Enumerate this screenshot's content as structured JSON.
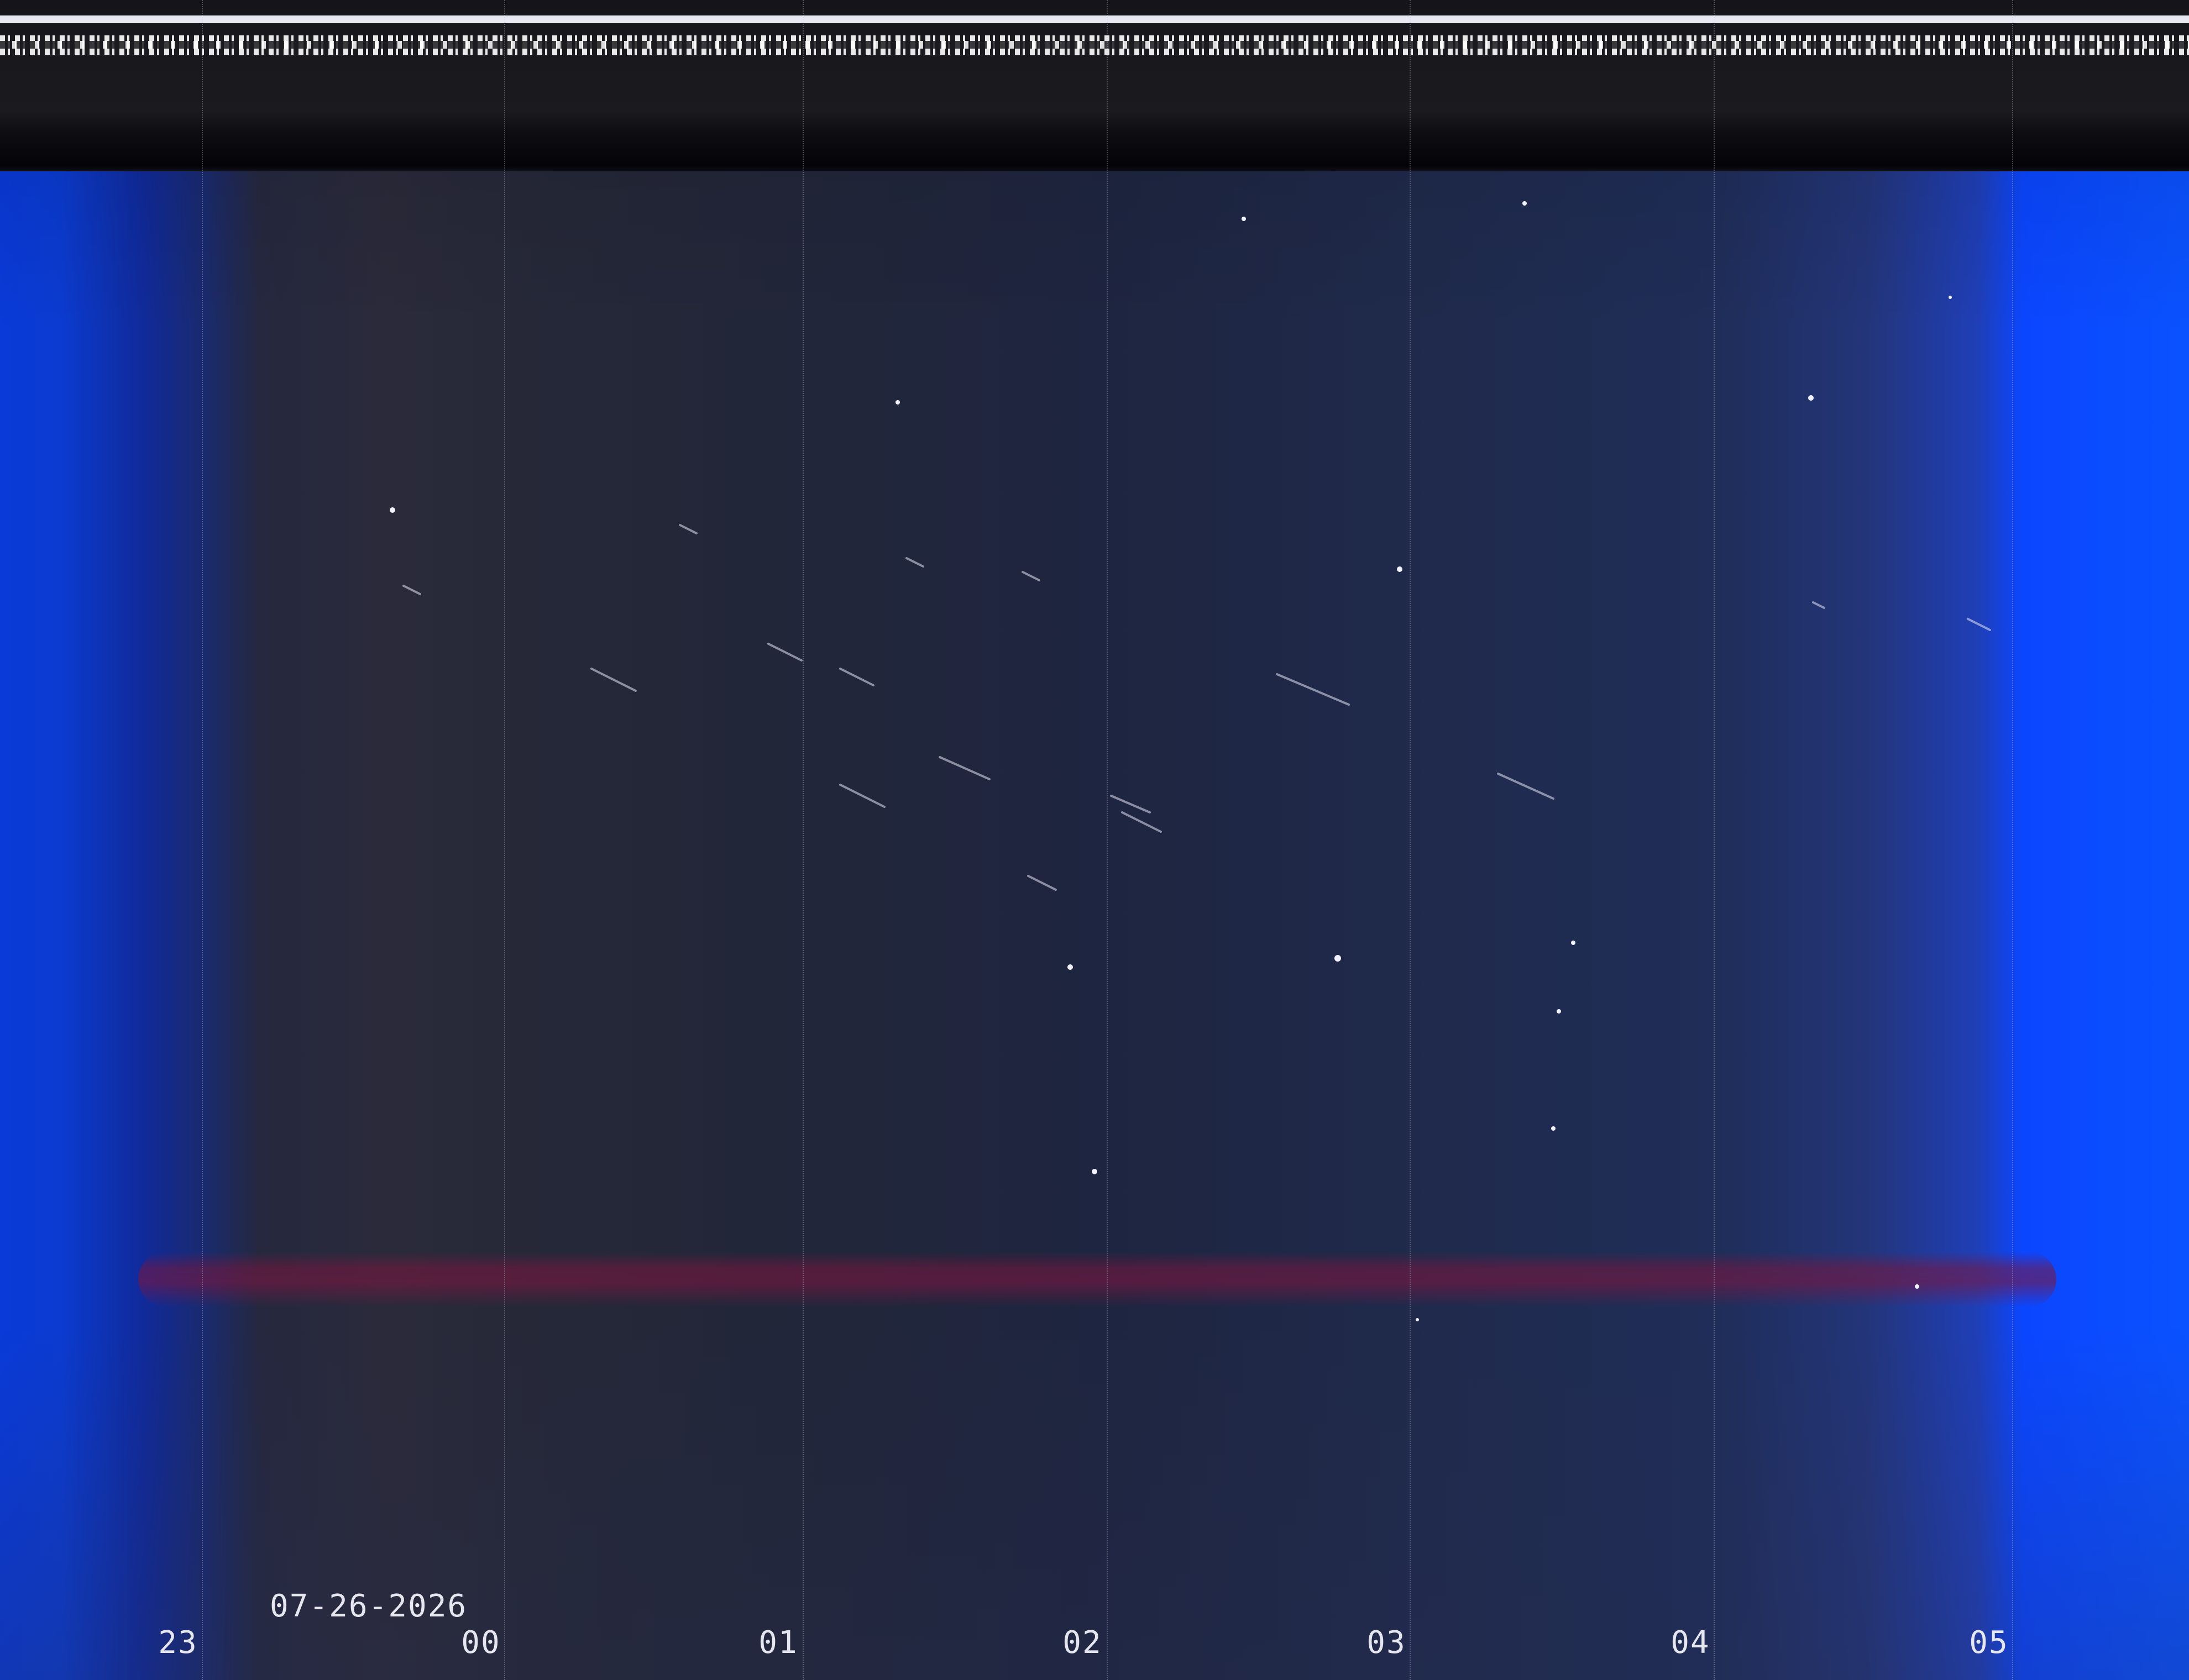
{
  "image": {
    "description_colors": {
      "sky": "#22263a",
      "dawn_edge": "#0a4cff",
      "dusk_edge": "#0a3ad8",
      "red_band": "#7a1640",
      "label_text": "#e6e6ee",
      "header": "#15151b"
    }
  },
  "timeline": {
    "date": "07-26-2026",
    "hours": [
      {
        "label": "23"
      },
      {
        "label": "00"
      },
      {
        "label": "01"
      },
      {
        "label": "02"
      },
      {
        "label": "03"
      },
      {
        "label": "04"
      },
      {
        "label": "05"
      }
    ]
  }
}
